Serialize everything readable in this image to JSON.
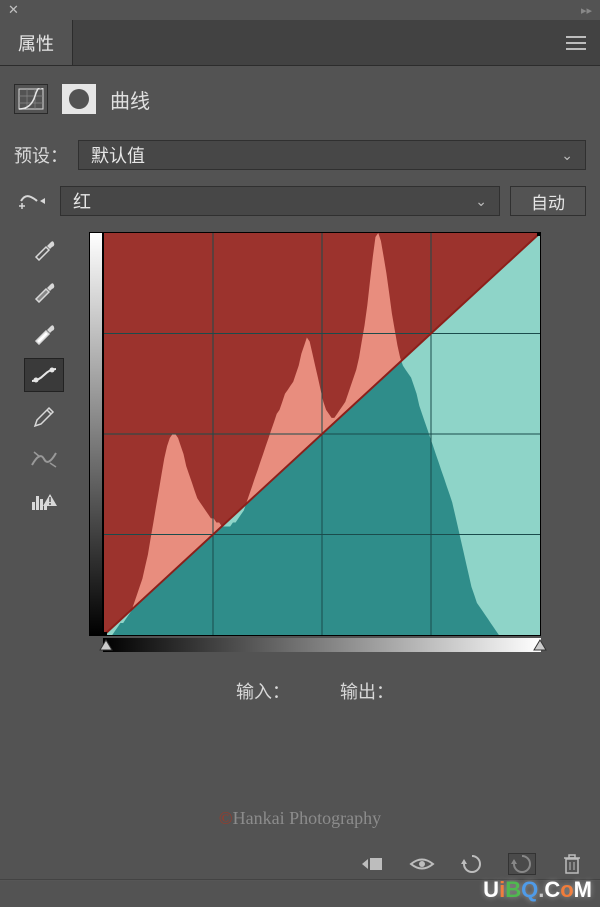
{
  "tab_label": "属性",
  "panel_title": "曲线",
  "preset": {
    "label": "预设：",
    "value": "默认值"
  },
  "channel": {
    "value": "红"
  },
  "auto_label": "自动",
  "io": {
    "input_label": "输入：",
    "output_label": "输出："
  },
  "watermark": {
    "copy": "©",
    "text": "Hankai Photography"
  },
  "uibq": {
    "u": "U",
    "i": "i",
    "b": "B",
    "q": "Q",
    "dot": ".",
    "c": "C",
    "o": "o",
    "m": "M"
  },
  "chart_data": {
    "type": "curves",
    "channel": "red",
    "curve_points": [
      [
        0,
        0
      ],
      [
        255,
        255
      ]
    ],
    "grid": {
      "cols": 4,
      "rows": 4
    },
    "histogram_max": 100,
    "histogram": [
      0,
      0,
      0,
      0,
      1,
      2,
      3,
      3,
      4,
      5,
      6,
      8,
      10,
      12,
      14,
      17,
      20,
      24,
      28,
      32,
      36,
      40,
      44,
      47,
      49,
      50,
      50,
      49,
      47,
      45,
      42,
      40,
      38,
      36,
      34,
      33,
      32,
      31,
      30,
      29,
      29,
      28,
      28,
      27,
      27,
      27,
      27,
      28,
      28,
      29,
      30,
      31,
      33,
      35,
      37,
      39,
      41,
      43,
      45,
      47,
      49,
      51,
      53,
      55,
      56,
      58,
      60,
      61,
      62,
      63,
      65,
      67,
      70,
      72,
      74,
      73,
      70,
      67,
      64,
      61,
      58,
      56,
      55,
      54,
      54,
      55,
      56,
      57,
      58,
      60,
      62,
      64,
      66,
      69,
      73,
      77,
      82,
      88,
      94,
      99,
      100,
      98,
      94,
      90,
      85,
      80,
      76,
      72,
      69,
      67,
      66,
      65,
      64,
      62,
      60,
      57,
      55,
      53,
      51,
      49,
      47,
      45,
      43,
      41,
      39,
      37,
      35,
      33,
      30,
      27,
      24,
      21,
      18,
      15,
      12,
      10,
      8,
      7,
      6,
      5,
      4,
      3,
      2,
      1,
      0,
      0,
      0,
      0,
      0,
      0,
      0,
      0,
      0,
      0,
      0,
      0,
      0,
      0,
      0,
      0
    ]
  }
}
